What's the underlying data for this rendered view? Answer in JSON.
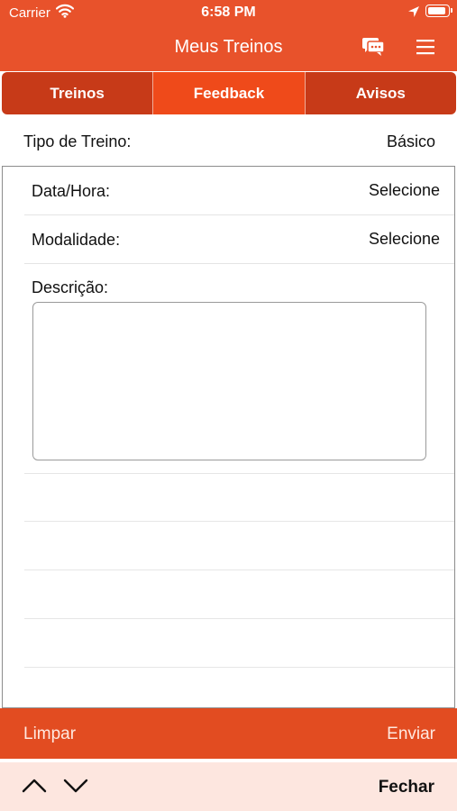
{
  "status_bar": {
    "carrier": "Carrier",
    "time": "6:58 PM",
    "wifi_icon": "wifi-icon",
    "location_icon": "location-arrow-icon",
    "battery_icon": "battery-icon"
  },
  "nav": {
    "title": "Meus Treinos",
    "chat_icon": "chat-bubbles-icon",
    "menu_icon": "hamburger-menu-icon"
  },
  "tabs": [
    {
      "label": "Treinos",
      "active": false
    },
    {
      "label": "Feedback",
      "active": true
    },
    {
      "label": "Avisos",
      "active": false
    }
  ],
  "training_type": {
    "label": "Tipo de Treino:",
    "value": "Básico"
  },
  "form": {
    "date_label": "Data/Hora:",
    "date_value": "Selecione",
    "modality_label": "Modalidade:",
    "modality_value": "Selecione",
    "description_label": "Descrição:",
    "description_value": ""
  },
  "actions": {
    "clear": "Limpar",
    "send": "Enviar"
  },
  "keyboard_toolbar": {
    "prev_icon": "chevron-up-icon",
    "next_icon": "chevron-down-icon",
    "close": "Fechar"
  },
  "colors": {
    "brand": "#e8522b",
    "tab_active": "#ef4a1a",
    "tab_inactive": "#c73a18",
    "accessory_bg": "#fde6df"
  }
}
